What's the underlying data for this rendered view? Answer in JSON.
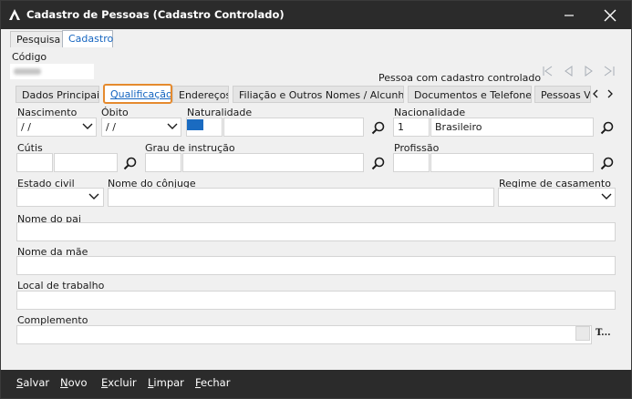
{
  "window": {
    "title": "Cadastro de Pessoas (Cadastro Controlado)"
  },
  "main_tabs": [
    {
      "label": "Pesquisa"
    },
    {
      "label": "Cadastro"
    }
  ],
  "header": {
    "codigo_label": "Código",
    "controlled_text": "Pessoa com cadastro controlado"
  },
  "sub_tabs": [
    {
      "label": "Dados Principais"
    },
    {
      "label": "Qualificação"
    },
    {
      "label": "Endereços"
    },
    {
      "label": "Filiação e Outros Nomes / Alcunhas"
    },
    {
      "label": "Documentos e Telefones"
    },
    {
      "label": "Pessoas Vi"
    }
  ],
  "form": {
    "nascimento_label": "Nascimento",
    "nascimento_value": " / /",
    "obito_label": "Óbito",
    "obito_value": " / /",
    "naturalidade_label": "Naturalidade",
    "nacionalidade_label": "Nacionalidade",
    "nacionalidade_code": "1",
    "nacionalidade_value": "Brasileiro",
    "cutis_label": "Cútis",
    "grau_label": "Grau de instrução",
    "profissao_label": "Profissão",
    "estado_civil_label": "Estado civil",
    "conjuge_label": "Nome do cônjuge",
    "regime_label": "Regime de casamento",
    "pai_label": "Nome do pai",
    "mae_label": "Nome da mãe",
    "trabalho_label": "Local de trabalho",
    "complemento_label": "Complemento",
    "t_button": "T..."
  },
  "footer": {
    "salvar": "Salvar",
    "novo": "Novo",
    "excluir": "Excluir",
    "limpar": "Limpar",
    "fechar": "Fechar"
  },
  "icons": {
    "lens": "magnifier-icon",
    "chevron": "chevron-down-icon"
  }
}
